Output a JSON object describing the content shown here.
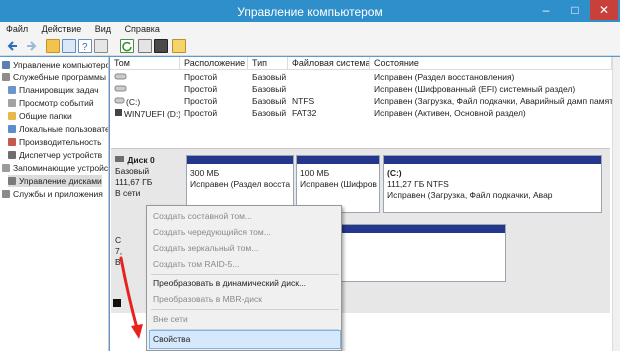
{
  "window": {
    "title": "Управление компьютером",
    "minimize": "–",
    "maximize": "□",
    "close": "✕"
  },
  "menu": [
    "Файл",
    "Действие",
    "Вид",
    "Справка"
  ],
  "toolbar_icons": [
    "back-arrow-icon",
    "forward-arrow-icon",
    "up-folder-icon",
    "tree-view-icon",
    "help-icon",
    "properties-icon",
    "refresh-icon",
    "export-icon",
    "properties-sheet-icon",
    "help-book-icon"
  ],
  "tree": [
    "Управление компьютером",
    "Служебные программы",
    "Планировщик задач",
    "Просмотр событий",
    "Общие папки",
    "Локальные пользователи",
    "Производительность",
    "Диспетчер устройств",
    "Запоминающие устройства",
    "Управление дисками",
    "Службы и приложения"
  ],
  "table": {
    "headers": [
      "Том",
      "Расположение",
      "Тип",
      "Файловая система",
      "Состояние"
    ],
    "rows": [
      [
        "",
        "Простой",
        "Базовый",
        "",
        "Исправен (Раздел восстановления)"
      ],
      [
        "",
        "Простой",
        "Базовый",
        "",
        "Исправен (Шифрованный (EFI) системный раздел)"
      ],
      [
        "(C:)",
        "Простой",
        "Базовый",
        "NTFS",
        "Исправен (Загрузка, Файл подкачки, Аварийный дамп памяти,"
      ],
      [
        "WIN7UEFI (D:)",
        "Простой",
        "Базовый",
        "FAT32",
        "Исправен (Активен, Основной раздел)"
      ]
    ]
  },
  "disk0": {
    "name": "Диск 0",
    "type": "Базовый",
    "size": "111,67 ГБ",
    "status": "В сети",
    "partitions": [
      {
        "size": "300 МБ",
        "desc": "Исправен (Раздел восста"
      },
      {
        "size": "100 МБ",
        "desc": "Исправен (Шифров"
      },
      {
        "name": "(C:)",
        "size": "111,27 ГБ NTFS",
        "desc": "Исправен (Загрузка, Файл подкачки, Авар"
      }
    ]
  },
  "disk1_partial": {
    "line1": "С",
    "line2": "7,",
    "line3": "В"
  },
  "context_menu": {
    "items": [
      {
        "label": "Создать составной том...",
        "enabled": false
      },
      {
        "label": "Создать чередующийся том...",
        "enabled": false
      },
      {
        "label": "Создать зеркальный том...",
        "enabled": false
      },
      {
        "label": "Создать том RAID-5...",
        "enabled": false
      },
      {
        "label": "Преобразовать в динамический диск...",
        "enabled": true
      },
      {
        "label": "Преобразовать в MBR-диск",
        "enabled": false
      },
      {
        "label": "Вне сети",
        "enabled": false
      },
      {
        "label": "Свойства",
        "enabled": true,
        "highlighted": true
      }
    ]
  },
  "colors": {
    "titlebar": "#2f8fcb",
    "partition_bar": "#24378c",
    "arrow": "#e8231f",
    "menu_highlight": "#d6e8fb"
  }
}
